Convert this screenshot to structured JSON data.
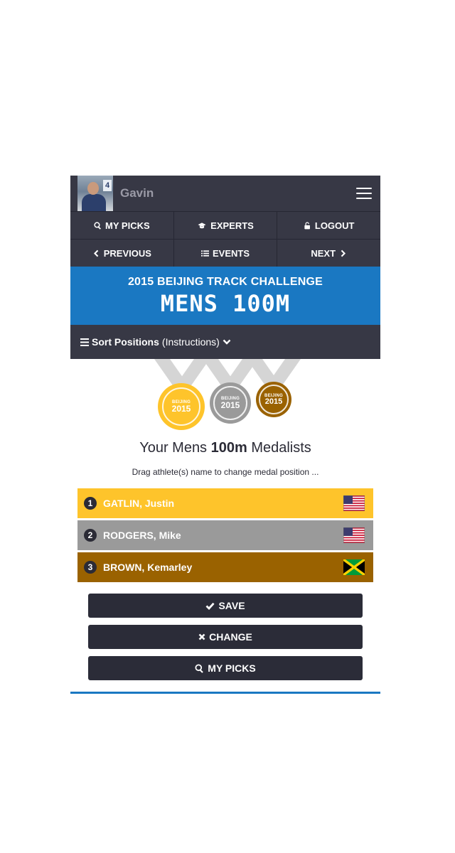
{
  "header": {
    "username": "Gavin",
    "avatar_sign": "4"
  },
  "nav": {
    "my_picks": "MY PICKS",
    "experts": "EXPERTS",
    "logout": "LOGOUT",
    "previous": "PREVIOUS",
    "events": "EVENTS",
    "next": "NEXT"
  },
  "banner": {
    "subtitle": "2015 BEIJING TRACK CHALLENGE",
    "title": "MENS 100M"
  },
  "sort": {
    "label": "Sort Positions",
    "instructions": "(Instructions)"
  },
  "medals": [
    {
      "line1": "BEIJING",
      "line2": "2015",
      "color": "#fec42b"
    },
    {
      "line1": "BEIJING",
      "line2": "2015",
      "color": "#9a9a9a"
    },
    {
      "line1": "BEIJING",
      "line2": "2015",
      "color": "#9a6200"
    }
  ],
  "medalists": {
    "prefix": "Your Mens ",
    "event": "100m",
    "suffix": " Medalists",
    "hint": "Drag athlete(s) name to change medal position ..."
  },
  "athletes": [
    {
      "position": "1",
      "name": "GATLIN, Justin",
      "country": "USA",
      "color": "#fec42b"
    },
    {
      "position": "2",
      "name": "RODGERS, Mike",
      "country": "USA",
      "color": "#9a9a9a"
    },
    {
      "position": "3",
      "name": "BROWN, Kemarley",
      "country": "JAM",
      "color": "#9a6200"
    }
  ],
  "actions": {
    "save": "SAVE",
    "change": "CHANGE",
    "my_picks": "MY PICKS"
  }
}
